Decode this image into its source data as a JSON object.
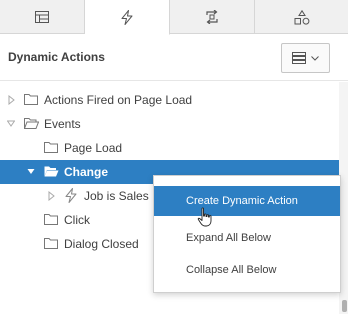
{
  "tabs": [
    {
      "icon": "layout-grid-icon",
      "active": false
    },
    {
      "icon": "lightning-icon",
      "active": true
    },
    {
      "icon": "process-arrows-icon",
      "active": false
    },
    {
      "icon": "shared-components-icon",
      "active": false
    }
  ],
  "header": {
    "title": "Dynamic Actions",
    "menu_icon": "menu-lines-icon"
  },
  "tree": {
    "nodes": [
      {
        "label": "Actions Fired on Page Load",
        "icon": "folder-icon",
        "expanded": false
      },
      {
        "label": "Events",
        "icon": "folder-open-icon",
        "expanded": true
      },
      {
        "label": "Page Load",
        "icon": "folder-icon"
      },
      {
        "label": "Change",
        "icon": "folder-open-icon",
        "expanded": true,
        "selected": true
      },
      {
        "label": "Job is Sales",
        "icon": "lightning-icon"
      },
      {
        "label": "Click",
        "icon": "folder-icon"
      },
      {
        "label": "Dialog Closed",
        "icon": "folder-icon"
      }
    ]
  },
  "context_menu": {
    "items": [
      {
        "label": "Create Dynamic Action",
        "highlighted": true
      },
      {
        "label": "Expand All Below",
        "highlighted": false
      },
      {
        "label": "Collapse All Below",
        "highlighted": false
      }
    ]
  },
  "colors": {
    "selection": "#2d7fc3",
    "tab_bar": "#f0f0f0",
    "text": "#404040"
  }
}
